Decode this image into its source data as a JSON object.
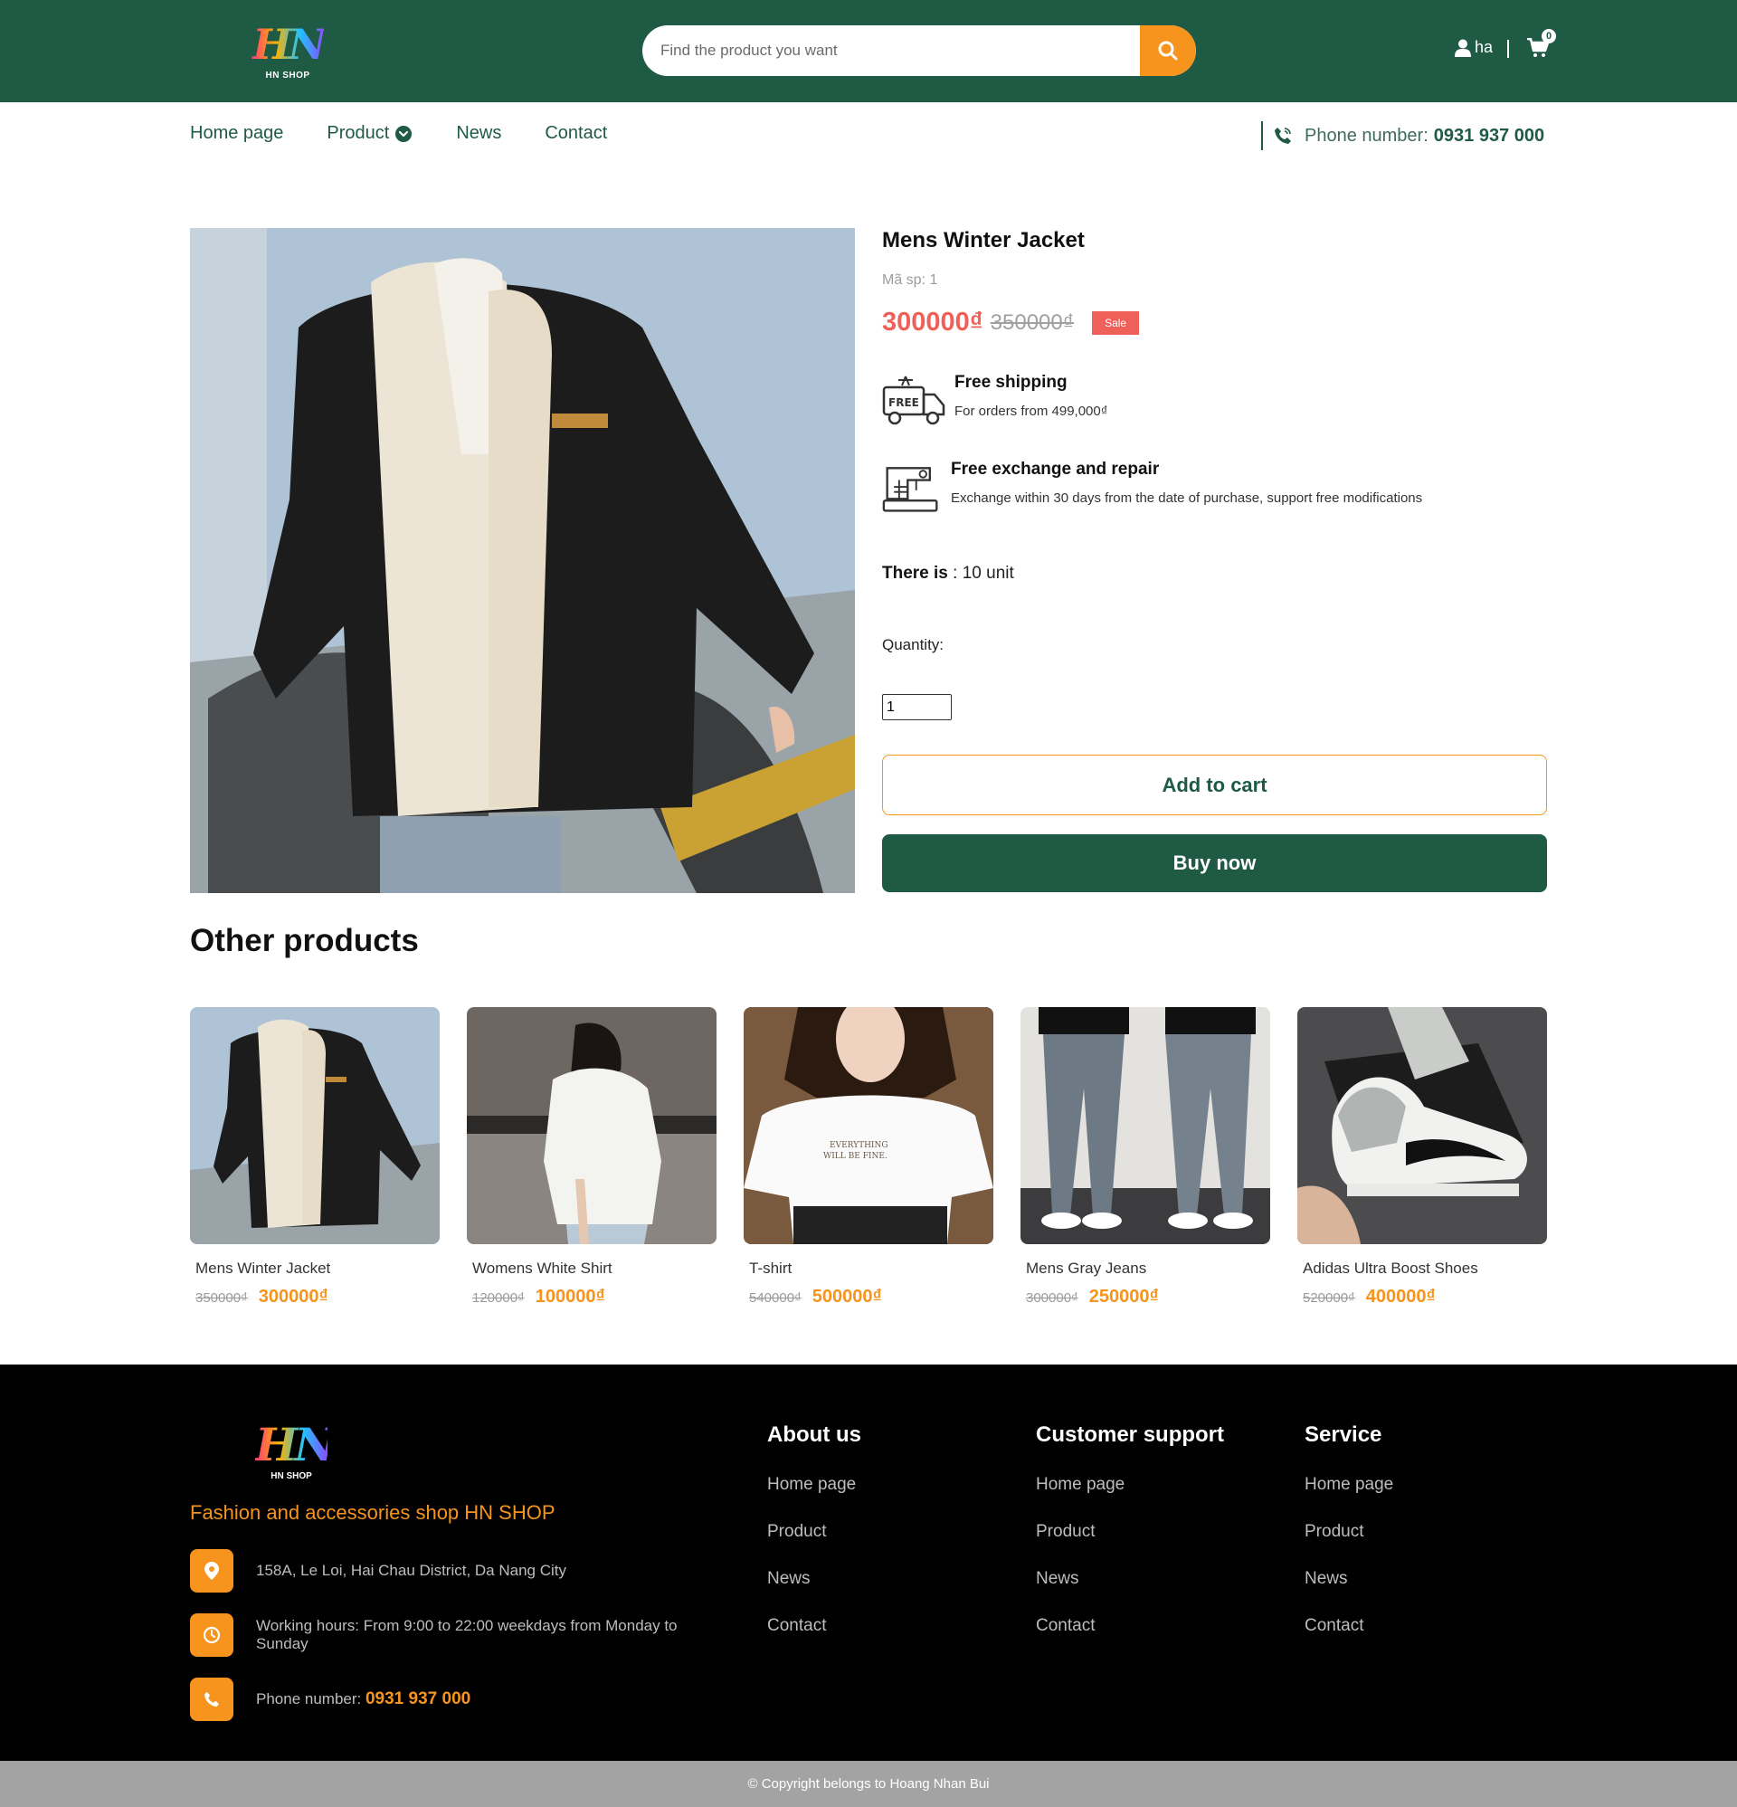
{
  "header": {
    "logo_mark": "HN",
    "logo_sub": "HN SHOP",
    "search_placeholder": "Find the product you want",
    "user_name": "ha",
    "cart_count": "0"
  },
  "nav": {
    "items": [
      "Home page",
      "Product",
      "News",
      "Contact"
    ],
    "phone_label": "Phone number:",
    "phone_number": "0931 937 000"
  },
  "product": {
    "title": "Mens Winter Jacket",
    "sku": "Mã sp: 1",
    "price_new": "300000₫",
    "price_old": "350000₫",
    "sale_badge": "Sale",
    "features": [
      {
        "title": "Free shipping",
        "desc": "For orders from 499,000₫"
      },
      {
        "title": "Free exchange and repair",
        "desc": "Exchange within 30 days from the date of purchase, support free modifications"
      }
    ],
    "stock_label": "There is",
    "stock_value": ": 10 unit",
    "quantity_label": "Quantity:",
    "quantity_value": "1",
    "add_to_cart": "Add to cart",
    "buy_now": "Buy now"
  },
  "other": {
    "title": "Other products",
    "items": [
      {
        "name": "Mens Winter Jacket",
        "old": "350000₫",
        "new": "300000₫"
      },
      {
        "name": "Womens White Shirt",
        "old": "120000₫",
        "new": "100000₫"
      },
      {
        "name": "T-shirt",
        "old": "540000₫",
        "new": "500000₫"
      },
      {
        "name": "Mens Gray Jeans",
        "old": "300000₫",
        "new": "250000₫"
      },
      {
        "name": "Adidas Ultra Boost Shoes",
        "old": "520000₫",
        "new": "400000₫"
      }
    ]
  },
  "footer": {
    "logo_mark": "HN",
    "logo_sub": "HN SHOP",
    "tagline": "Fashion and accessories shop HN SHOP",
    "address": "158A, Le Loi, Hai Chau District, Da Nang City",
    "hours": "Working hours: From 9:00 to 22:00 weekdays from Monday to Sunday",
    "phone_label": "Phone number:",
    "phone_number": "0931 937 000",
    "columns": [
      {
        "title": "About us",
        "links": [
          "Home page",
          "Product",
          "News",
          "Contact"
        ]
      },
      {
        "title": "Customer support",
        "links": [
          "Home page",
          "Product",
          "News",
          "Contact"
        ]
      },
      {
        "title": "Service",
        "links": [
          "Home page",
          "Product",
          "News",
          "Contact"
        ]
      }
    ],
    "copyright": "© Copyright belongs to Hoang Nhan Bui"
  },
  "colors": {
    "brand_green": "#1f5a45",
    "accent_orange": "#f7941d",
    "sale_red": "#f0605a"
  },
  "icons": [
    "search-icon",
    "user-icon",
    "cart-icon",
    "chevron-down-icon",
    "phone-icon",
    "free-shipping-icon",
    "sewing-machine-icon",
    "location-icon",
    "clock-icon"
  ]
}
